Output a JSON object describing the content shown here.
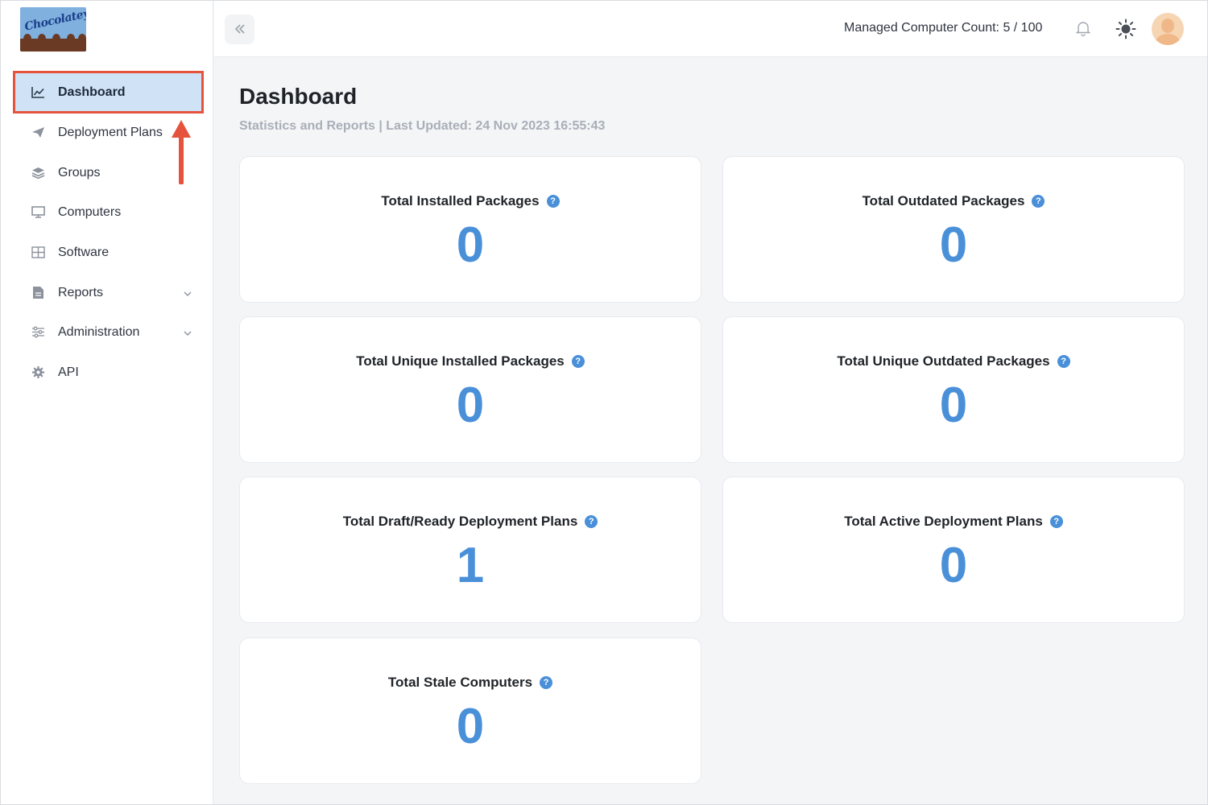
{
  "app": {
    "logo_text": "Chocolatey"
  },
  "sidebar": {
    "items": [
      {
        "label": "Dashboard",
        "icon": "chart-line-icon"
      },
      {
        "label": "Deployment Plans",
        "icon": "paper-plane-icon"
      },
      {
        "label": "Groups",
        "icon": "layers-icon"
      },
      {
        "label": "Computers",
        "icon": "desktop-icon"
      },
      {
        "label": "Software",
        "icon": "grid-icon"
      },
      {
        "label": "Reports",
        "icon": "file-report-icon"
      },
      {
        "label": "Administration",
        "icon": "sliders-icon"
      },
      {
        "label": "API",
        "icon": "gear-icon"
      }
    ]
  },
  "header": {
    "managed_count": "Managed Computer Count: 5 / 100"
  },
  "main": {
    "title": "Dashboard",
    "subtitle": "Statistics and Reports | Last Updated: 24 Nov 2023 16:55:43",
    "cards": [
      {
        "title": "Total Installed Packages",
        "value": "0"
      },
      {
        "title": "Total Outdated Packages",
        "value": "0"
      },
      {
        "title": "Total Unique Installed Packages",
        "value": "0"
      },
      {
        "title": "Total Unique Outdated Packages",
        "value": "0"
      },
      {
        "title": "Total Draft/Ready Deployment Plans",
        "value": "1"
      },
      {
        "title": "Total Active Deployment Plans",
        "value": "0"
      },
      {
        "title": "Total Stale Computers",
        "value": "0"
      }
    ]
  },
  "colors": {
    "accent": "#4a90d9",
    "active_bg": "#cfe2f6",
    "highlight": "#e5533d"
  }
}
